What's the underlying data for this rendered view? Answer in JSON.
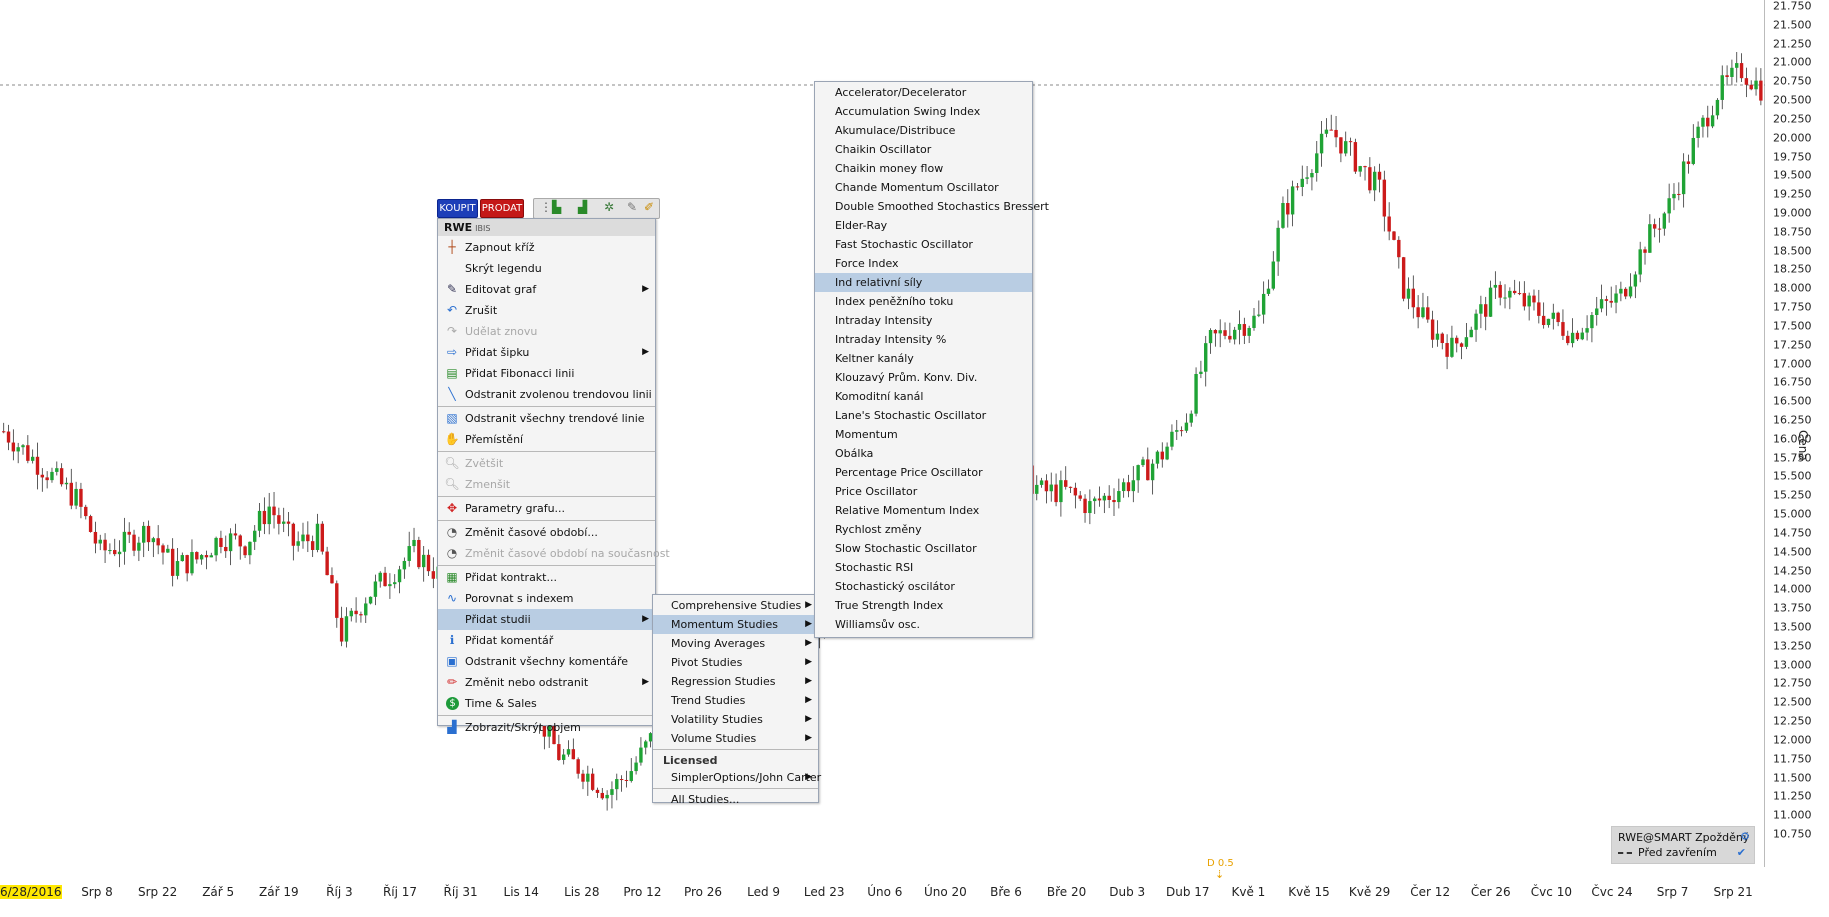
{
  "chart": {
    "symbol": "RWE",
    "exchange": "IBIS",
    "y_axis_label": "Cena",
    "legend_line1": "RWE@SMART Zpožděný",
    "legend_line2": "Před zavřením",
    "dividend_marker": "D 0.5",
    "up_color": "#1fa335",
    "down_color": "#cc1a1a",
    "ref_line_value": 20.7
  },
  "chart_data": {
    "type": "candlestick",
    "y_ticks": [
      "21.750",
      "21.500",
      "21.250",
      "21.000",
      "20.750",
      "20.500",
      "20.250",
      "20.000",
      "19.750",
      "19.500",
      "19.250",
      "19.000",
      "18.750",
      "18.500",
      "18.250",
      "18.000",
      "17.750",
      "17.500",
      "17.250",
      "17.000",
      "16.750",
      "16.500",
      "16.250",
      "16.000",
      "15.750",
      "15.500",
      "15.250",
      "15.000",
      "14.750",
      "14.500",
      "14.250",
      "14.000",
      "13.750",
      "13.500",
      "13.250",
      "13.000",
      "12.750",
      "12.500",
      "12.250",
      "12.000",
      "11.750",
      "11.500",
      "11.250",
      "11.000",
      "10.750"
    ],
    "ylim": [
      10.5,
      21.85
    ],
    "x_ticks": [
      "6/28/2016",
      "Srp 8",
      "Srp 22",
      "Zář 5",
      "Zář 19",
      "Říj 3",
      "Říj 17",
      "Říj 31",
      "Lis 14",
      "Lis 28",
      "Pro 12",
      "Pro 26",
      "Led 9",
      "Led 23",
      "Úno 6",
      "Úno 20",
      "Bře 6",
      "Bře 20",
      "Dub 3",
      "Dub 17",
      "Kvě 1",
      "Kvě 15",
      "Kvě 29",
      "Čer 12",
      "Čer 26",
      "Čvc 10",
      "Čvc 24",
      "Srp 7",
      "Srp 21"
    ],
    "series_close_path": [
      [
        0,
        16.1
      ],
      [
        5,
        15.8
      ],
      [
        10,
        15.5
      ],
      [
        15,
        15.2
      ],
      [
        20,
        14.5
      ],
      [
        25,
        14.6
      ],
      [
        30,
        14.8
      ],
      [
        35,
        14.3
      ],
      [
        40,
        14.4
      ],
      [
        45,
        14.7
      ],
      [
        50,
        14.6
      ],
      [
        55,
        15.1
      ],
      [
        60,
        14.6
      ],
      [
        65,
        14.7
      ],
      [
        70,
        13.4
      ],
      [
        75,
        13.9
      ],
      [
        80,
        14.2
      ],
      [
        85,
        14.5
      ],
      [
        90,
        14.2
      ],
      [
        95,
        14.1
      ],
      [
        100,
        13.8
      ],
      [
        105,
        13.3
      ],
      [
        110,
        12.4
      ],
      [
        115,
        11.8
      ],
      [
        120,
        11.6
      ],
      [
        125,
        11.3
      ],
      [
        130,
        11.6
      ],
      [
        135,
        12.1
      ],
      [
        140,
        12.9
      ],
      [
        145,
        12.8
      ],
      [
        150,
        12.3
      ],
      [
        155,
        12.1
      ],
      [
        160,
        12.8
      ],
      [
        165,
        13.4
      ],
      [
        170,
        13.5
      ],
      [
        175,
        14.1
      ],
      [
        180,
        14.4
      ],
      [
        185,
        14.7
      ],
      [
        190,
        14.6
      ],
      [
        195,
        15.0
      ],
      [
        200,
        15.5
      ],
      [
        205,
        15.7
      ],
      [
        210,
        15.6
      ],
      [
        215,
        15.3
      ],
      [
        220,
        15.3
      ],
      [
        225,
        15.1
      ],
      [
        230,
        15.3
      ],
      [
        235,
        15.5
      ],
      [
        240,
        15.8
      ],
      [
        245,
        16.3
      ],
      [
        250,
        17.3
      ],
      [
        255,
        17.5
      ],
      [
        260,
        17.6
      ],
      [
        265,
        19.0
      ],
      [
        270,
        19.6
      ],
      [
        275,
        20.1
      ],
      [
        280,
        19.7
      ],
      [
        285,
        19.3
      ],
      [
        290,
        18.0
      ],
      [
        295,
        17.5
      ],
      [
        300,
        17.2
      ],
      [
        305,
        17.6
      ],
      [
        310,
        18.0
      ],
      [
        315,
        17.8
      ],
      [
        320,
        17.6
      ],
      [
        325,
        17.4
      ],
      [
        330,
        17.7
      ],
      [
        335,
        17.9
      ],
      [
        340,
        18.6
      ],
      [
        345,
        19.1
      ],
      [
        350,
        19.9
      ],
      [
        355,
        20.6
      ],
      [
        360,
        20.9
      ],
      [
        365,
        20.6
      ]
    ]
  },
  "toolbar": {
    "buy_label": "KOUPIT",
    "sell_label": "PRODAT"
  },
  "context_menu": {
    "items": [
      {
        "label": "Zapnout kříž",
        "icon": "crosshair-icon",
        "disabled": false,
        "arrow": false
      },
      {
        "label": "Skrýt legendu",
        "icon": "",
        "disabled": false,
        "arrow": false
      },
      {
        "label": "Editovat graf",
        "icon": "edit-chart-icon",
        "disabled": false,
        "arrow": true
      },
      {
        "label": "Zrušit",
        "icon": "undo-icon",
        "disabled": false,
        "arrow": false
      },
      {
        "label": "Udělat znovu",
        "icon": "redo-icon",
        "disabled": true,
        "arrow": false
      },
      {
        "label": "Přidat šipku",
        "icon": "arrow-icon",
        "disabled": false,
        "arrow": true
      },
      {
        "label": "Přidat Fibonacci linii",
        "icon": "fibonacci-icon",
        "disabled": false,
        "arrow": false
      },
      {
        "label": "Odstranit zvolenou trendovou linii",
        "icon": "trendline-icon",
        "disabled": false,
        "arrow": false
      },
      {
        "label": "Odstranit všechny trendové linie",
        "icon": "trendlines-icon",
        "disabled": false,
        "arrow": false
      },
      {
        "label": "Přemístění",
        "icon": "hand-icon",
        "disabled": false,
        "arrow": false
      },
      {
        "label": "Zvětšit",
        "icon": "zoom-in-icon",
        "disabled": true,
        "arrow": false
      },
      {
        "label": "Zmenšit",
        "icon": "zoom-out-icon",
        "disabled": true,
        "arrow": false
      },
      {
        "label": "Parametry grafu...",
        "icon": "settings-icon",
        "disabled": false,
        "arrow": false
      },
      {
        "label": "Změnit časové období...",
        "icon": "clock-icon",
        "disabled": false,
        "arrow": false
      },
      {
        "label": "Změnit časové období na současnost",
        "icon": "clock-icon",
        "disabled": true,
        "arrow": false
      },
      {
        "label": "Přidat kontrakt...",
        "icon": "contract-icon",
        "disabled": false,
        "arrow": false
      },
      {
        "label": "Porovnat s indexem",
        "icon": "compare-icon",
        "disabled": false,
        "arrow": false
      },
      {
        "label": "Přidat studii",
        "icon": "",
        "disabled": false,
        "arrow": true,
        "selected": true
      },
      {
        "label": "Přidat komentář",
        "icon": "info-icon",
        "disabled": false,
        "arrow": false
      },
      {
        "label": "Odstranit všechny komentáře",
        "icon": "delete-comments-icon",
        "disabled": false,
        "arrow": false
      },
      {
        "label": "Změnit nebo odstranit",
        "icon": "pencil-icon",
        "disabled": false,
        "arrow": true
      },
      {
        "label": "Time & Sales",
        "icon": "dollar-icon",
        "disabled": false,
        "arrow": false
      },
      {
        "label": "Zobrazit/Skrýt objem",
        "icon": "volume-icon",
        "disabled": false,
        "arrow": false
      }
    ]
  },
  "studies_menu": {
    "items": [
      {
        "label": "Comprehensive Studies",
        "arrow": true
      },
      {
        "label": "Momentum Studies",
        "arrow": true,
        "selected": true
      },
      {
        "label": "Moving Averages",
        "arrow": true
      },
      {
        "label": "Pivot Studies",
        "arrow": true
      },
      {
        "label": "Regression Studies",
        "arrow": true
      },
      {
        "label": "Trend Studies",
        "arrow": true
      },
      {
        "label": "Volatility Studies",
        "arrow": true
      },
      {
        "label": "Volume Studies",
        "arrow": true
      }
    ],
    "licensed_header": "Licensed",
    "licensed_items": [
      {
        "label": "SimplerOptions/John Carter",
        "arrow": true
      }
    ],
    "all_studies": "All Studies..."
  },
  "momentum_menu": {
    "items": [
      "Accelerator/Decelerator",
      "Accumulation Swing Index",
      "Akumulace/Distribuce",
      "Chaikin Oscillator",
      "Chaikin money flow",
      "Chande Momentum Oscillator",
      "Double Smoothed Stochastics Bressert",
      "Elder-Ray",
      "Fast Stochastic Oscillator",
      "Force Index",
      "Ind relativní síly",
      "Index peněžního toku",
      "Intraday Intensity",
      "Intraday Intensity %",
      "Keltner kanály",
      "Klouzavý Prům. Konv. Div.",
      "Komoditní kanál",
      "Lane's Stochastic Oscillator",
      "Momentum",
      "Obálka",
      "Percentage Price Oscillator",
      "Price Oscillator",
      "Relative Momentum Index",
      "Rychlost změny",
      "Slow Stochastic Oscillator",
      "Stochastic RSI",
      "Stochastický oscilátor",
      "True Strength Index",
      "Williamsův osc."
    ],
    "selected_index": 10
  }
}
